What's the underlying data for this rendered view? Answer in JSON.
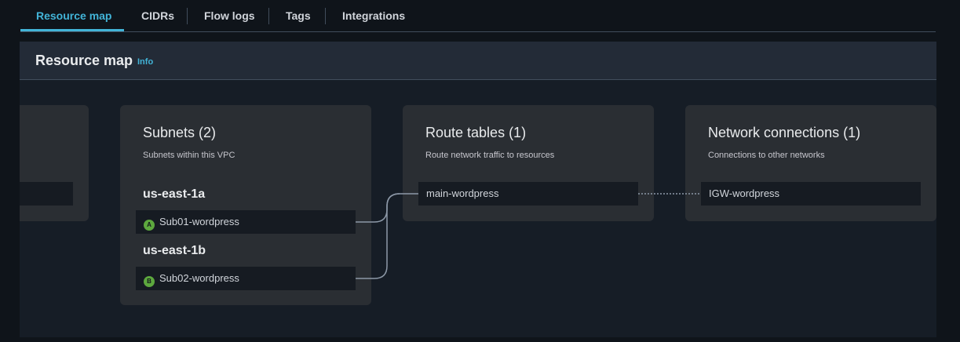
{
  "tabs": [
    {
      "label": "Resource map"
    },
    {
      "label": "CIDRs"
    },
    {
      "label": "Flow logs"
    },
    {
      "label": "Tags"
    },
    {
      "label": "Integrations"
    }
  ],
  "panel": {
    "title": "Resource map",
    "info": "Info"
  },
  "subnets": {
    "title": "Subnets (2)",
    "subtitle": "Subnets within this VPC",
    "zones": [
      {
        "label": "us-east-1a",
        "badge": "A",
        "subnet": "Sub01-wordpress"
      },
      {
        "label": "us-east-1b",
        "badge": "B",
        "subnet": "Sub02-wordpress"
      }
    ]
  },
  "route_tables": {
    "title": "Route tables (1)",
    "subtitle": "Route network traffic to resources",
    "items": [
      "main-wordpress"
    ]
  },
  "network_connections": {
    "title": "Network connections (1)",
    "subtitle": "Connections to other networks",
    "items": [
      "IGW-wordpress"
    ]
  },
  "colors": {
    "accent": "#42b4d8",
    "az_badge": "#5da83e",
    "connector": "#8d99a8"
  }
}
